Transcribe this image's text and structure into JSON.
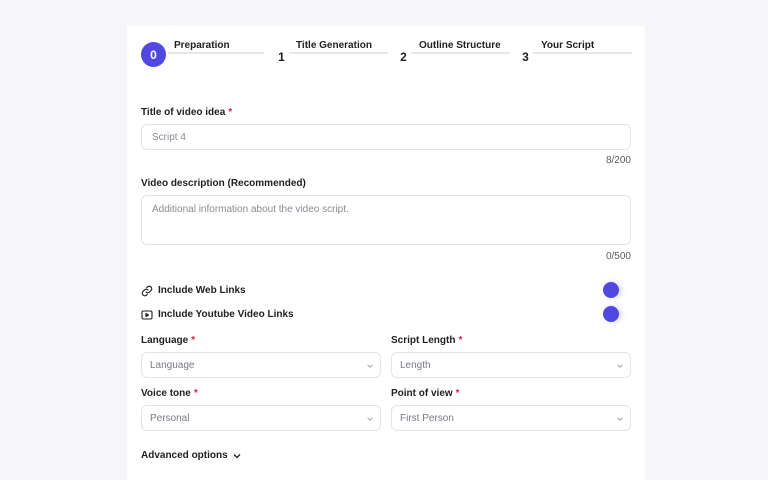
{
  "stepper": {
    "steps": [
      {
        "number": "0",
        "label": "Preparation",
        "active": true
      },
      {
        "number": "1",
        "label": "Title Generation",
        "active": false
      },
      {
        "number": "2",
        "label": "Outline Structure",
        "active": false
      },
      {
        "number": "3",
        "label": "Your Script",
        "active": false
      }
    ]
  },
  "title_field": {
    "label": "Title of video idea",
    "required_mark": "*",
    "value": "Script 4",
    "counter": "8/200"
  },
  "description_field": {
    "label": "Video description (Recommended)",
    "placeholder": "Additional information about the video script.",
    "counter": "0/500"
  },
  "toggles": {
    "web_links": {
      "label": "Include Web Links",
      "icon": "link-icon",
      "on": true
    },
    "youtube_links": {
      "label": "Include Youtube Video Links",
      "icon": "youtube-icon",
      "on": true
    }
  },
  "selects": {
    "language": {
      "label": "Language",
      "required_mark": "*",
      "value": "Language"
    },
    "script_length": {
      "label": "Script Length",
      "required_mark": "*",
      "value": "Length"
    },
    "voice_tone": {
      "label": "Voice tone",
      "required_mark": "*",
      "value": "Personal"
    },
    "point_of_view": {
      "label": "Point of view",
      "required_mark": "*",
      "value": "First Person"
    }
  },
  "advanced": {
    "label": "Advanced options",
    "icon": "chevron-down-icon"
  },
  "colors": {
    "accent": "#5048e0",
    "required": "#e11d48",
    "border": "#e4e4e9"
  }
}
